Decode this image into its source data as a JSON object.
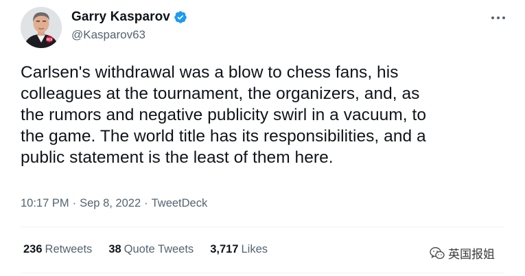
{
  "author": {
    "display_name": "Garry Kasparov",
    "handle": "@Kasparov63",
    "verified": true,
    "avatar_icon": "profile-photo"
  },
  "tweet": {
    "text": "Carlsen's withdrawal was a blow to chess fans, his\ncolleagues at the tournament, the organizers, and, as\nthe rumors and negative publicity swirl in a vacuum, to\nthe game. The world title has its responsibilities, and a\npublic statement is the least of them here."
  },
  "meta": {
    "time": "10:17 PM",
    "separator": "·",
    "date": "Sep 8, 2022",
    "source": "TweetDeck"
  },
  "stats": {
    "retweets_count": "236",
    "retweets_label": "Retweets",
    "quote_tweets_count": "38",
    "quote_tweets_label": "Quote Tweets",
    "likes_count": "3,717",
    "likes_label": "Likes"
  },
  "watermark": {
    "text": "英国报姐",
    "icon": "wechat-icon"
  },
  "colors": {
    "text_primary": "#0f1419",
    "text_secondary": "#536471",
    "verified_blue": "#1d9bf0",
    "divider": "#eff3f4"
  }
}
